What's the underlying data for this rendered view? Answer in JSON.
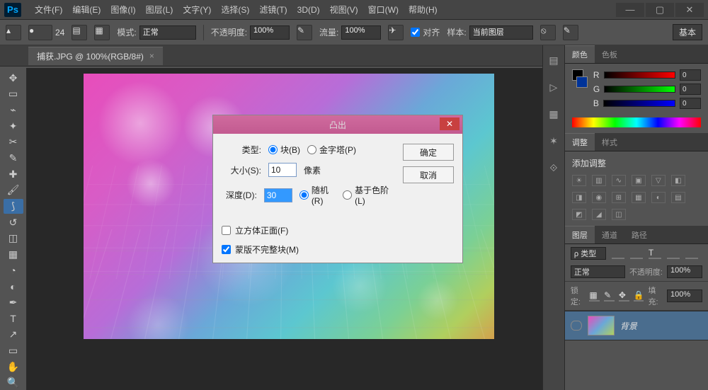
{
  "app": {
    "logo": "Ps"
  },
  "menu": [
    "文件(F)",
    "编辑(E)",
    "图像(I)",
    "图层(L)",
    "文字(Y)",
    "选择(S)",
    "滤镜(T)",
    "3D(D)",
    "视图(V)",
    "窗口(W)",
    "帮助(H)"
  ],
  "options": {
    "brush_size": "24",
    "mode_label": "模式:",
    "mode_value": "正常",
    "opacity_label": "不透明度:",
    "opacity_value": "100%",
    "flow_label": "流量:",
    "flow_value": "100%",
    "align_label": "对齐",
    "sample_label": "样本:",
    "sample_value": "当前图层",
    "basic": "基本"
  },
  "doc_tab": {
    "title": "捕获.JPG @ 100%(RGB/8#)",
    "close": "×"
  },
  "color_panel": {
    "tabs": [
      "颜色",
      "色板"
    ],
    "channels": [
      {
        "label": "R",
        "value": "0"
      },
      {
        "label": "G",
        "value": "0"
      },
      {
        "label": "B",
        "value": "0"
      }
    ],
    "fg": "#000000",
    "bg": "#003399"
  },
  "adjust_panel": {
    "tabs": [
      "调整",
      "样式"
    ],
    "heading": "添加调整"
  },
  "layers_panel": {
    "tabs": [
      "图层",
      "通道",
      "路径"
    ],
    "filter_label": "ρ 类型",
    "blend": "正常",
    "opacity_label": "不透明度:",
    "opacity_value": "100%",
    "lock_label": "锁定:",
    "fill_label": "填充:",
    "fill_value": "100%",
    "layer_name": "背景"
  },
  "dialog": {
    "title": "凸出",
    "type_label": "类型:",
    "type_block": "块(B)",
    "type_pyramid": "金字塔(P)",
    "size_label": "大小(S):",
    "size_value": "10",
    "size_unit": "像素",
    "depth_label": "深度(D):",
    "depth_value": "30",
    "depth_random": "随机(R)",
    "depth_level": "基于色阶(L)",
    "solid_front": "立方体正面(F)",
    "mask_incomplete": "蒙版不完整块(M)",
    "ok": "确定",
    "cancel": "取消"
  }
}
